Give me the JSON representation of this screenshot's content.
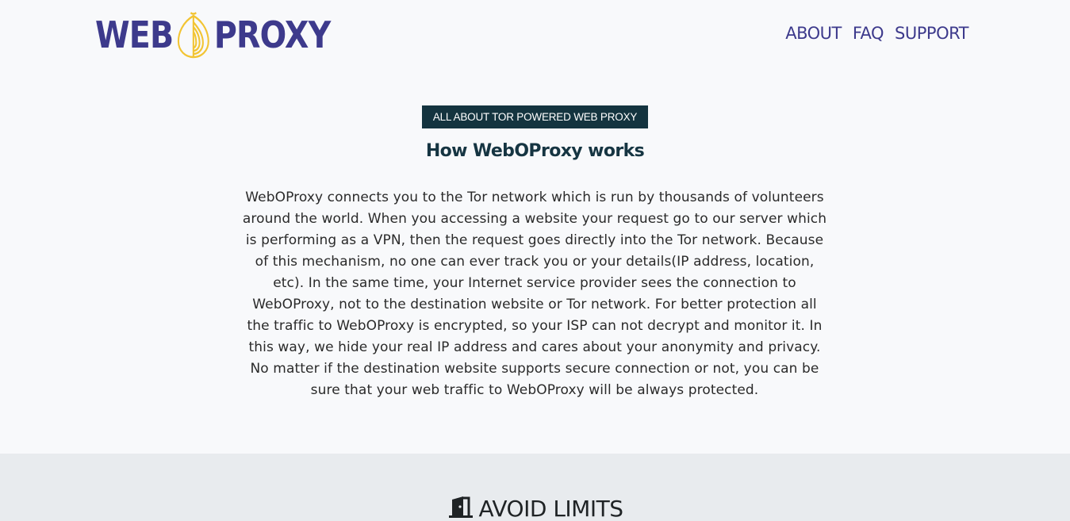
{
  "header": {
    "logo_left": "WEB",
    "logo_right": "PROXY",
    "nav": [
      {
        "label": "ABOUT"
      },
      {
        "label": "FAQ"
      },
      {
        "label": "SUPPORT"
      }
    ]
  },
  "hero": {
    "badge": "ALL ABOUT TOR POWERED WEB PROXY",
    "title": "How WebOProxy works",
    "body": "WebOProxy connects you to the Tor network which is run by thousands of volunteers around the world. When you accessing a website your request go to our server which is performing as a VPN, then the request goes directly into the Tor network. Because of this mechanism, no one can ever track you or your details(IP address, location, etc). In the same time, your Internet service provider sees the connection to WebOProxy, not to the destination website or Tor network. For better protection all the traffic to WebOProxy is encrypted, so your ISP can not decrypt and monitor it. In this way, we hide your real IP address and cares about your anonymity and privacy. No matter if the destination website supports secure connection or not, you can be sure that your web traffic to WebOProxy will be always protected."
  },
  "section2": {
    "icon": "door-icon",
    "title": "AVOID LIMITS"
  },
  "colors": {
    "brand": "#3d3a8c",
    "onion": "#f2c433",
    "badge_bg": "#14343f",
    "page_bg": "#f8f9fb",
    "section_bg": "#e8ebee"
  }
}
